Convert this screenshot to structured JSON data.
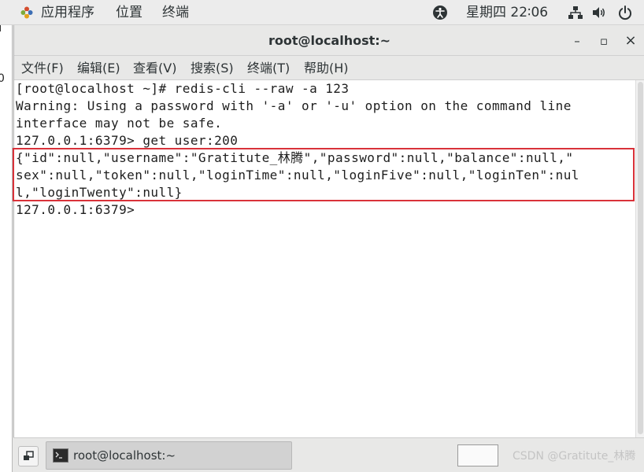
{
  "panel": {
    "applications": "应用程序",
    "places": "位置",
    "terminal": "终端",
    "clock": "星期四 22∶06"
  },
  "desktop": {
    "edge_text": "0"
  },
  "window": {
    "title": "root@localhost:~",
    "minimize": "–",
    "maximize": "▫",
    "close": "×"
  },
  "menu": {
    "file": "文件(F)",
    "edit": "编辑(E)",
    "view": "查看(V)",
    "search": "搜索(S)",
    "terminal": "终端(T)",
    "help": "帮助(H)"
  },
  "terminal": {
    "lines": [
      "[root@localhost ~]# redis-cli --raw -a 123",
      "Warning: Using a password with '-a' or '-u' option on the command line",
      "interface may not be safe.",
      "127.0.0.1:6379> get user:200",
      "{\"id\":null,\"username\":\"Gratitute_林腾\",\"password\":null,\"balance\":null,\"",
      "sex\":null,\"token\":null,\"loginTime\":null,\"loginFive\":null,\"loginTen\":nul",
      "l,\"loginTwenty\":null}",
      "127.0.0.1:6379>"
    ]
  },
  "taskbar": {
    "task_label": "root@localhost:~",
    "watermark": "CSDN @Gratitute_林腾"
  },
  "colors": {
    "highlight_border": "#d9323a",
    "panel_bg": "#ececec",
    "terminal_bg": "#ffffff"
  },
  "icons": [
    "apps-icon",
    "accessibility-icon",
    "network-icon",
    "volume-icon",
    "power-icon",
    "terminal-icon",
    "show-desktop-icon"
  ]
}
